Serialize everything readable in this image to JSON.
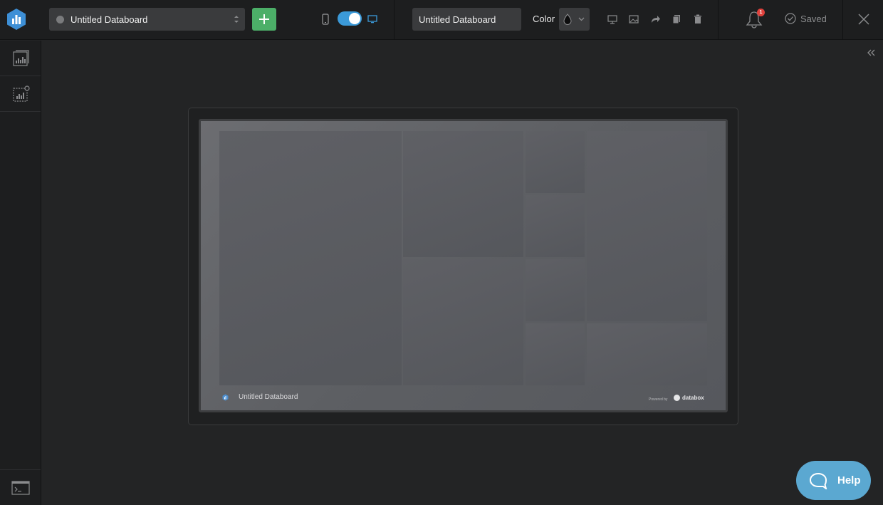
{
  "topbar": {
    "board_select_label": "Untitled Databoard",
    "board_name_value": "Untitled Databoard",
    "color_label": "Color",
    "notification_count": "1",
    "saved_label": "Saved"
  },
  "preview": {
    "title": "Untitled Databoard",
    "powered_by": "Powered by",
    "brand": "databox"
  },
  "help": {
    "label": "Help"
  },
  "icons": {
    "logo": "databox-logo-icon",
    "add": "plus-icon",
    "mobile": "mobile-icon",
    "desktop": "desktop-icon",
    "color": "droplet-icon",
    "tools": [
      "presentation-icon",
      "image-icon",
      "share-icon",
      "copy-icon",
      "trash-icon"
    ],
    "bell": "bell-icon",
    "saved": "check-circle-icon",
    "close": "close-icon",
    "sidebar": [
      "datablock-library-icon",
      "custom-datablock-icon",
      "terminal-icon"
    ],
    "collapse": "chevron-double-left-icon",
    "help": "chat-bubble-icon"
  },
  "colors": {
    "background": "#232425",
    "topbar": "#1d1e1f",
    "accent_green": "#4caf68",
    "accent_blue": "#3b9ad9",
    "help_blue": "#5ba8d1",
    "badge_red": "#e0413c"
  }
}
